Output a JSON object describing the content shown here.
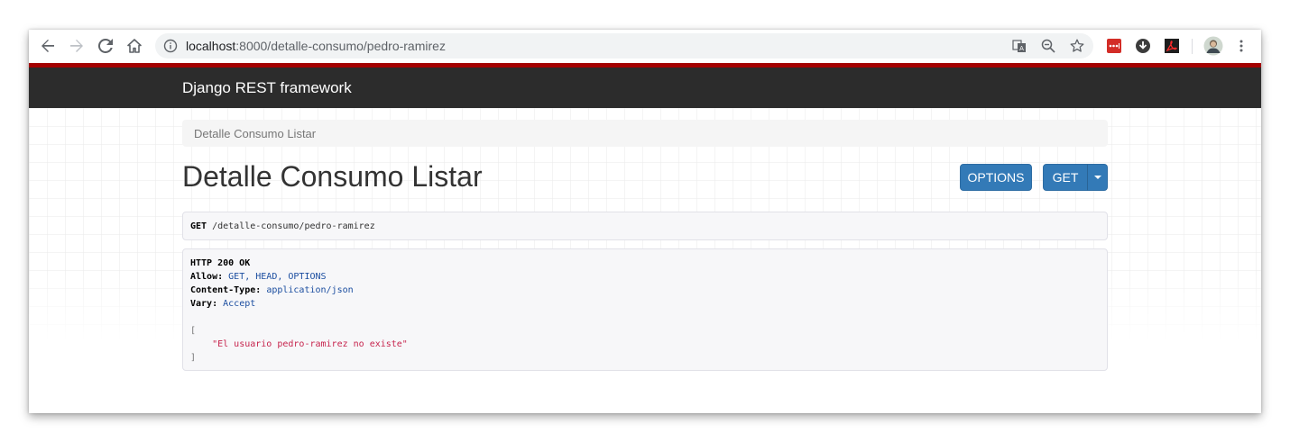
{
  "browser": {
    "url_host": "localhost",
    "url_rest": ":8000/detalle-consumo/pedro-ramirez"
  },
  "navbar": {
    "brand": "Django REST framework"
  },
  "breadcrumb": {
    "item": "Detalle Consumo Listar"
  },
  "page": {
    "title": "Detalle Consumo Listar",
    "options_button": "OPTIONS",
    "get_button": "GET"
  },
  "request": {
    "method": "GET",
    "path": "/detalle-consumo/pedro-ramirez"
  },
  "response": {
    "status_line": "HTTP 200 OK",
    "headers": [
      {
        "name": "Allow:",
        "value": "GET, HEAD, OPTIONS"
      },
      {
        "name": "Content-Type:",
        "value": "application/json"
      },
      {
        "name": "Vary:",
        "value": "Accept"
      }
    ],
    "body_open": "[",
    "body_item": "\"El usuario pedro-ramirez no existe\"",
    "body_close": "]"
  },
  "colors": {
    "navbar_bg": "#2c2c2c",
    "navbar_accent": "#a30000",
    "button_primary": "#337ab7",
    "string_red": "#c7254e",
    "header_value_blue": "#1c4ea0"
  },
  "icons": {
    "back": "arrow-back-icon",
    "forward": "arrow-forward-icon",
    "reload": "reload-icon",
    "home": "home-icon",
    "info": "info-icon",
    "translate": "translate-icon",
    "zoom": "zoom-out-icon",
    "bookmark": "star-icon",
    "ext_lastpass": "lastpass-icon",
    "ext_download": "download-icon",
    "ext_pdf": "acrobat-icon",
    "profile": "avatar",
    "menu": "more-vert-icon"
  }
}
